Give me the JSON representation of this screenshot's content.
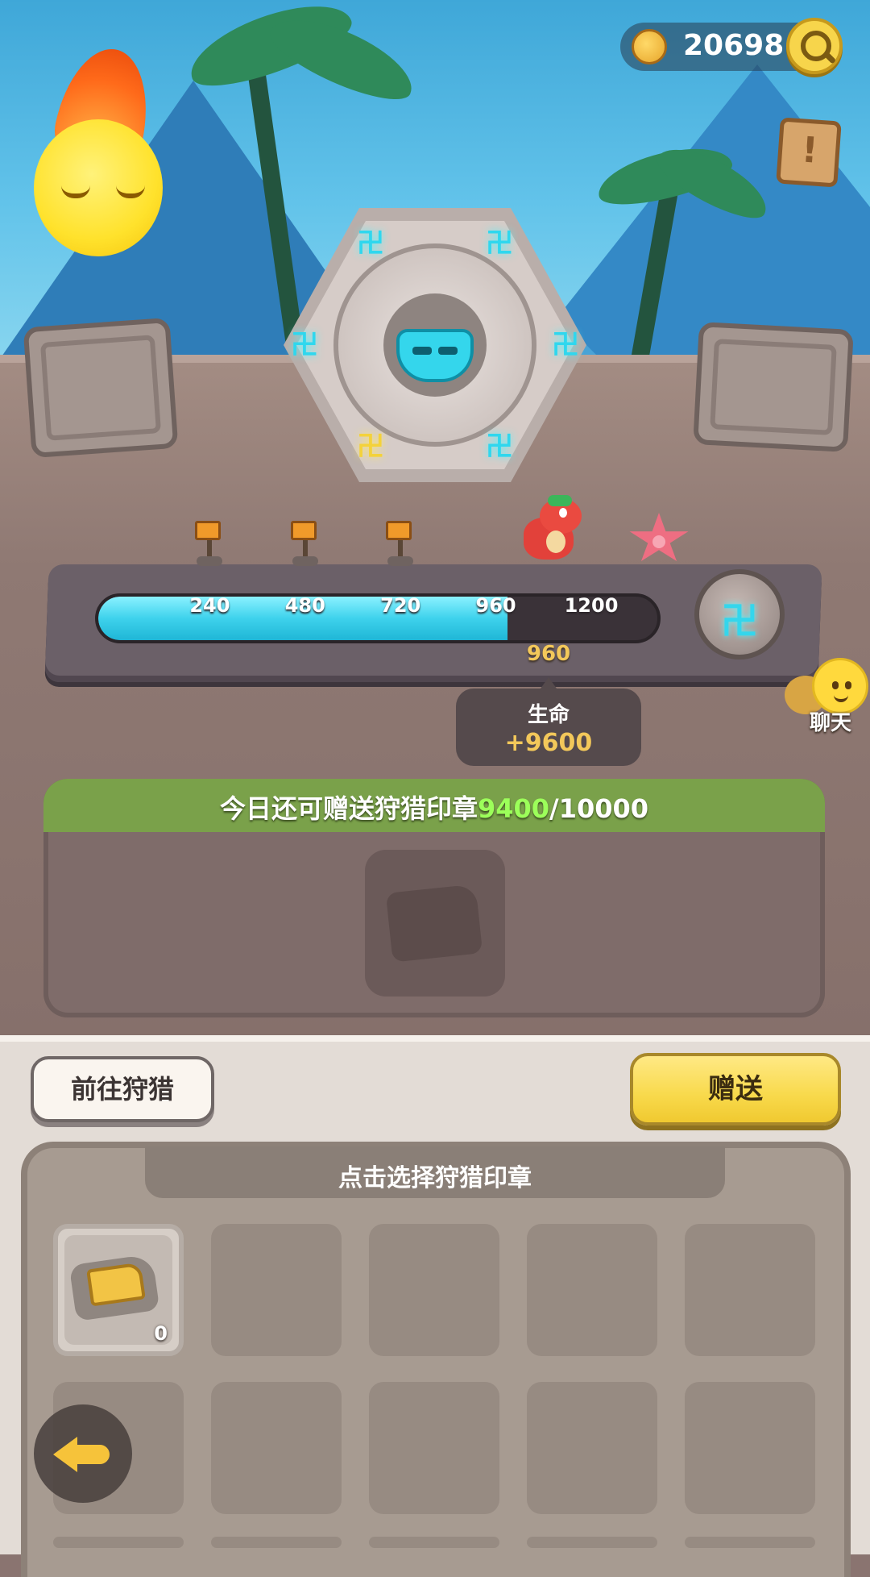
{
  "header": {
    "currency_value": "20698",
    "currency_icon": "flexed-arm-icon",
    "search_icon": "search-icon",
    "quest_icon": "scroll-exclamation-icon",
    "quest_mark": "!"
  },
  "wheel": {
    "runes": [
      "卍",
      "卍",
      "卍",
      "卍",
      "卍",
      "卍"
    ]
  },
  "progress": {
    "current": 960,
    "max": 1200,
    "current_label": "960",
    "milestones": [
      {
        "value": 240,
        "label": "240",
        "reward_icon": "orange-flag-icon"
      },
      {
        "value": 480,
        "label": "480",
        "reward_icon": "orange-flag-icon"
      },
      {
        "value": 720,
        "label": "720",
        "reward_icon": "orange-flag-icon"
      },
      {
        "value": 960,
        "label": "960",
        "reward_icon": "red-dino-pet-icon"
      },
      {
        "value": 1200,
        "label": "1200",
        "reward_icon": "pink-starfish-icon"
      }
    ],
    "medal_glyph": "卍"
  },
  "tooltip": {
    "stat": "生命",
    "bonus": "+9600"
  },
  "chat": {
    "label": "聊天"
  },
  "donate": {
    "prefix": "今日还可赠送狩猎印章",
    "remaining": "9400",
    "separator": "/",
    "limit": "10000",
    "accent_color": "#9cff5a"
  },
  "actions": {
    "hunt_label": "前往狩猎",
    "send_label": "赠送"
  },
  "inventory": {
    "title": "点击选择狩猎印章",
    "items": [
      {
        "icon": "hunting-seal-icon",
        "count": "0"
      }
    ]
  }
}
